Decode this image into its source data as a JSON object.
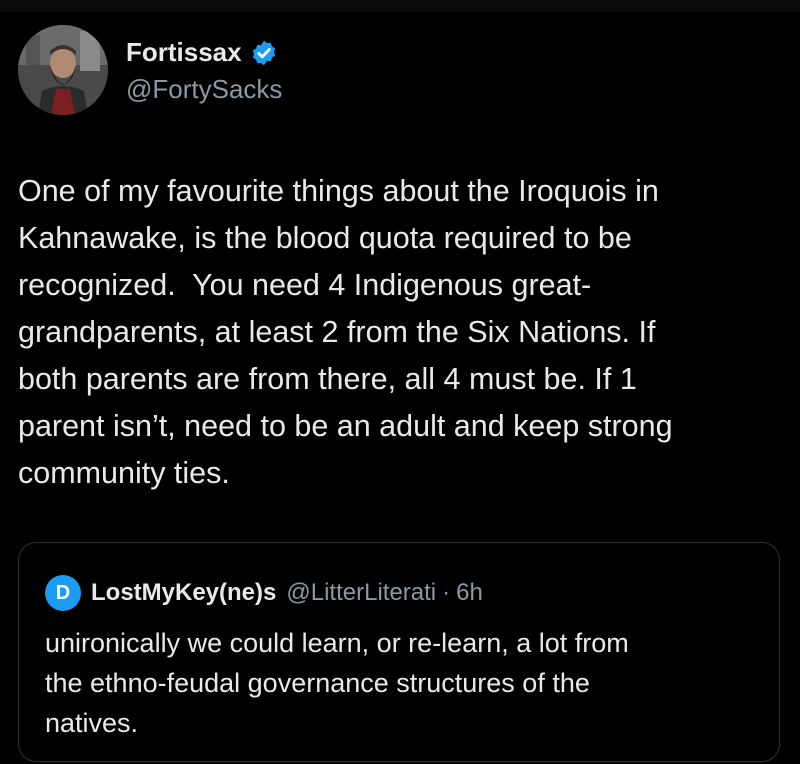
{
  "author": {
    "display_name": "Fortissax",
    "handle": "@FortySacks",
    "verified": true,
    "avatar_icon": "bearded-man-avatar"
  },
  "tweet": {
    "text": "One of my favourite things about the Iroquois in\nKahnawake, is the blood quota required to be\nrecognized.  You need 4 Indigenous great-\ngrandparents, at least 2 from the Six Nations. If\nboth parents are from there, all 4 must be. If 1\nparent isn’t, need to be an adult and keep strong\ncommunity ties."
  },
  "quote": {
    "avatar_letter": "D",
    "display_name": "LostMyKey(ne)s",
    "handle": "@LitterLiterati",
    "separator": "·",
    "time": "6h",
    "text": "unironically we could learn, or re-learn, a lot from\nthe ethno-feudal governance structures of the\nnatives."
  },
  "colors": {
    "background": "#000000",
    "text": "#e7e9ea",
    "secondary": "#8b98a5",
    "accent": "#1d9bf0",
    "border": "#2f3336"
  }
}
